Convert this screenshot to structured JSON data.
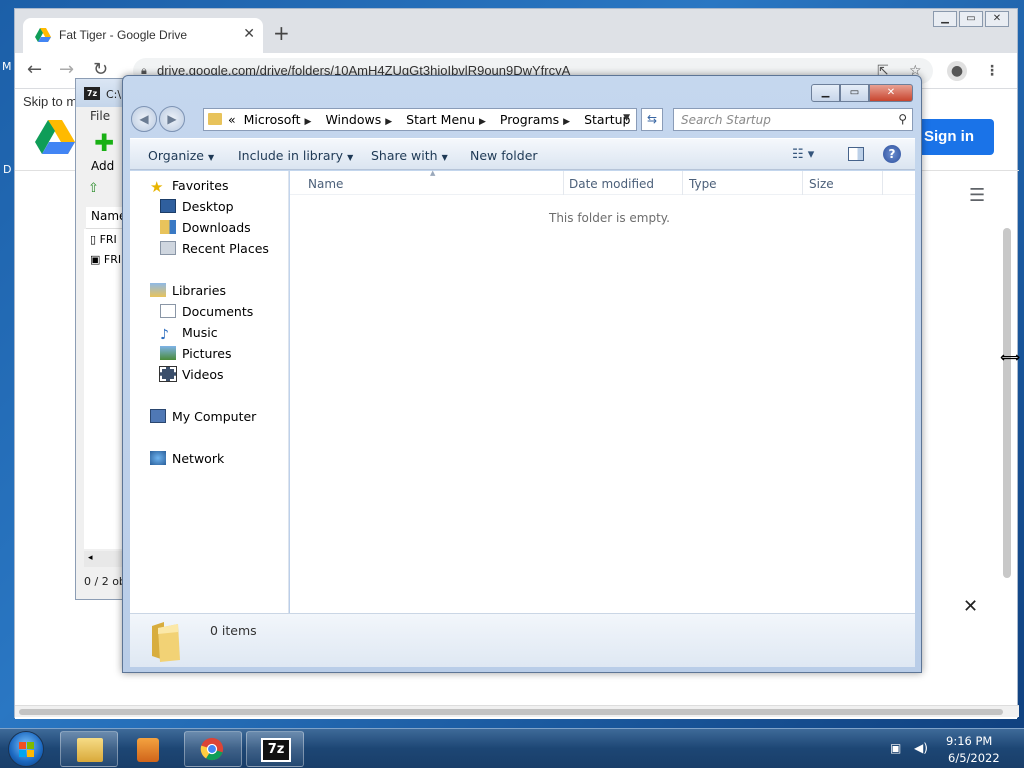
{
  "chrome": {
    "tab_title": "Fat Tiger - Google Drive",
    "url": "drive.google.com/drive/folders/10AmH4ZUgGt3hioIbvlR9oun9DwYfrcyA",
    "skip_text": "Skip to m",
    "signin_label": "Sign in",
    "left_label_1": "M",
    "left_label_2": "D"
  },
  "sevenzip": {
    "window_title": "C:\\",
    "menu_file": "File",
    "add_label": "Add",
    "col_name": "Name",
    "rows": [
      "FRI",
      "FRI"
    ],
    "status": "0 / 2 ob"
  },
  "explorer": {
    "breadcrumbs": [
      "Microsoft",
      "Windows",
      "Start Menu",
      "Programs",
      "Startup"
    ],
    "overflow": "«",
    "search_placeholder": "Search Startup",
    "commands": {
      "organize": "Organize",
      "include": "Include in library",
      "share": "Share with",
      "newfolder": "New folder"
    },
    "nav": {
      "favorites": "Favorites",
      "desktop": "Desktop",
      "downloads": "Downloads",
      "recent": "Recent Places",
      "libraries": "Libraries",
      "documents": "Documents",
      "music": "Music",
      "pictures": "Pictures",
      "videos": "Videos",
      "computer": "My Computer",
      "network": "Network"
    },
    "columns": {
      "name": "Name",
      "date": "Date modified",
      "type": "Type",
      "size": "Size"
    },
    "empty_message": "This folder is empty.",
    "item_count": "0 items"
  },
  "taskbar": {
    "time": "9:16 PM",
    "date": "6/5/2022"
  }
}
